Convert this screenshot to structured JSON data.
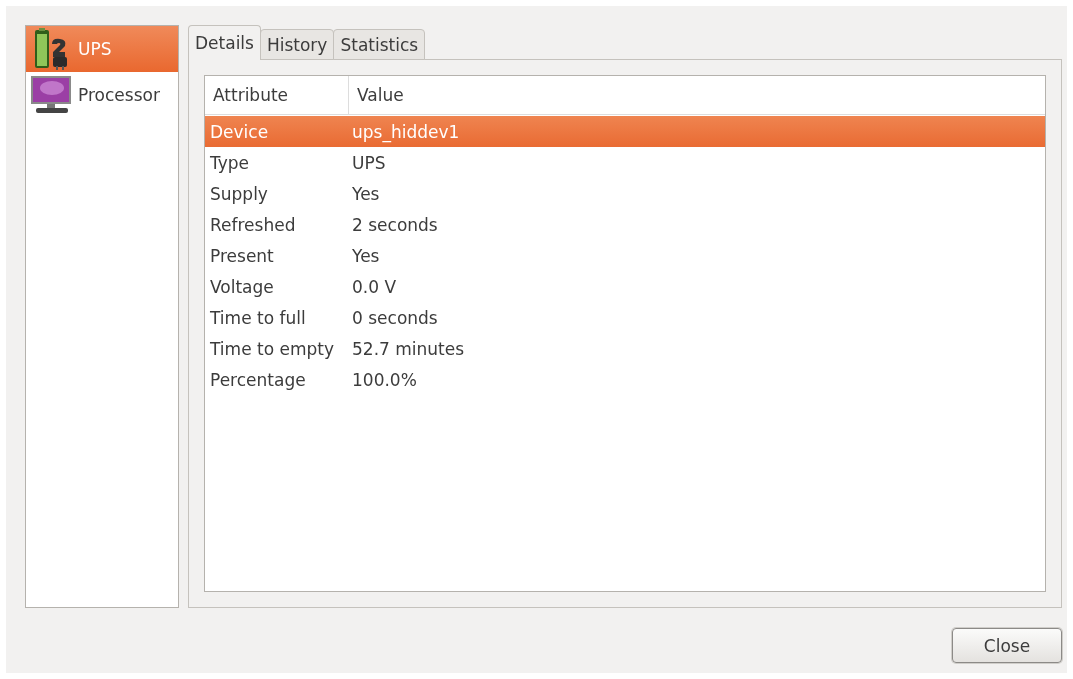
{
  "devices": [
    {
      "label": "UPS",
      "kind": "ups",
      "selected": true
    },
    {
      "label": "Processor",
      "kind": "processor",
      "selected": false
    }
  ],
  "tabs": [
    {
      "label": "Details",
      "selected": true
    },
    {
      "label": "History",
      "selected": false
    },
    {
      "label": "Statistics",
      "selected": false
    }
  ],
  "table": {
    "columns": [
      "Attribute",
      "Value"
    ],
    "rows": [
      {
        "cells": [
          "Device",
          "ups_hiddev1"
        ],
        "selected": true
      },
      {
        "cells": [
          "Type",
          "UPS"
        ],
        "selected": false
      },
      {
        "cells": [
          "Supply",
          "Yes"
        ],
        "selected": false
      },
      {
        "cells": [
          "Refreshed",
          "2 seconds"
        ],
        "selected": false
      },
      {
        "cells": [
          "Present",
          "Yes"
        ],
        "selected": false
      },
      {
        "cells": [
          "Voltage",
          "0.0 V"
        ],
        "selected": false
      },
      {
        "cells": [
          "Time to full",
          "0 seconds"
        ],
        "selected": false
      },
      {
        "cells": [
          "Time to empty",
          "52.7 minutes"
        ],
        "selected": false
      },
      {
        "cells": [
          "Percentage",
          "100.0%"
        ],
        "selected": false
      }
    ]
  },
  "buttons": [
    "Close"
  ]
}
